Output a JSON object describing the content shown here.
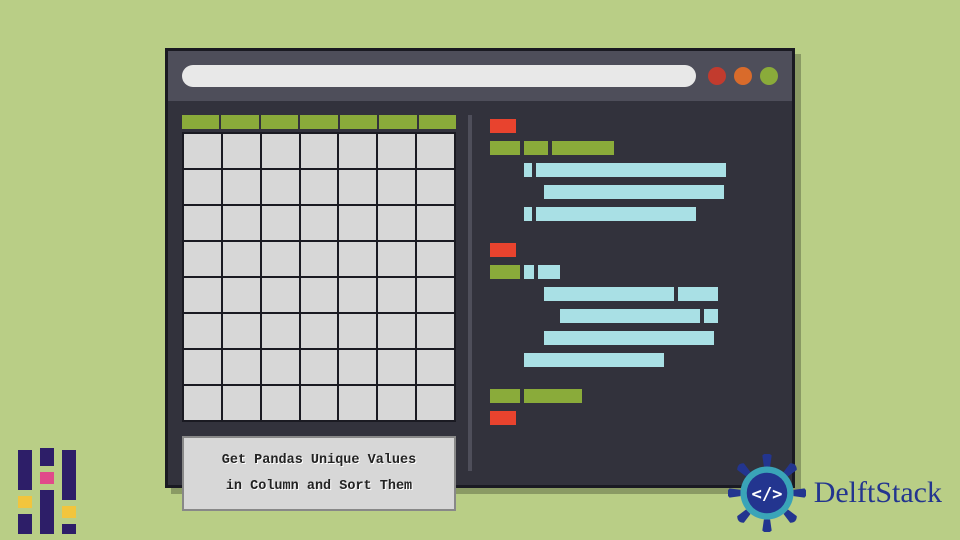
{
  "window": {
    "traffic_lights": [
      "red",
      "orange",
      "green"
    ]
  },
  "grid": {
    "columns": 7,
    "rows": 8
  },
  "caption": {
    "line1": "Get Pandas Unique Values",
    "line2": "in Column and Sort Them"
  },
  "brand": {
    "name": "DelftStack"
  },
  "code_tokens": {
    "comment": "Decorative code-token illustration (no actual text)"
  },
  "icons": {
    "gear": "gear-badge-icon",
    "code": "code-angle-icon"
  },
  "colors": {
    "bg": "#b9ce86",
    "window": "#32323c",
    "titlebar": "#4e4e5a",
    "accent_green": "#8aab3a",
    "accent_red": "#e8432e",
    "accent_cyan": "#a9e0e5",
    "brand_blue": "#23358f"
  }
}
